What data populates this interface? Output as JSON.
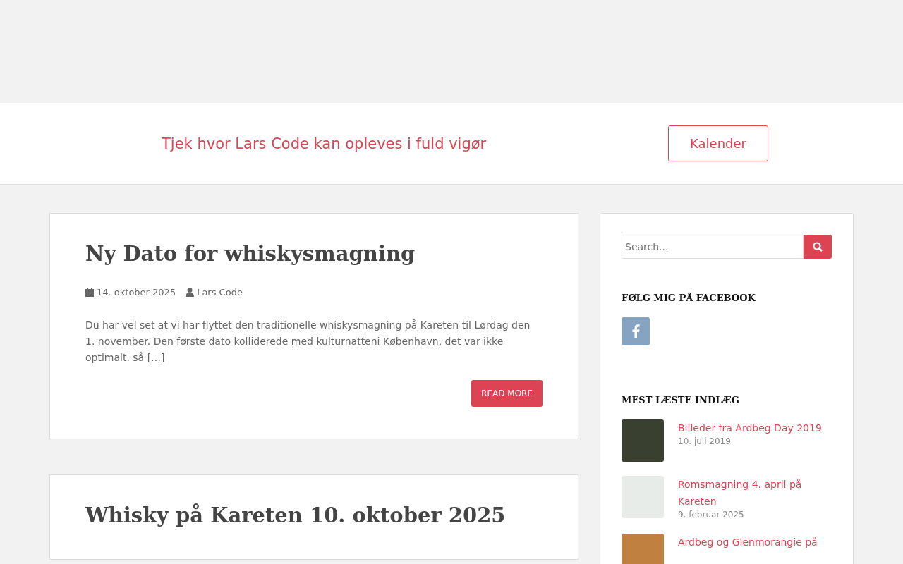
{
  "banner": {
    "text": "Tjek hvor Lars Code kan opleves i fuld vigør",
    "button": "Kalender"
  },
  "posts": [
    {
      "title": "Ny Dato for whiskysmagning",
      "date": "14. oktober 2025",
      "author": "Lars Code",
      "excerpt": "Du har vel set at vi har flyttet den traditionelle whiskysmagning på Kareten til Lørdag den 1. november. Den første dato kolliderede med kulturnatteni København, det var ikke optimalt. så […]",
      "button": "READ MORE"
    },
    {
      "title": "Whisky på Kareten 10. oktober 2025"
    }
  ],
  "sidebar": {
    "search": {
      "placeholder": "Search..."
    },
    "facebook_heading": "FØLG MIG PÅ FACEBOOK",
    "popular_heading": "MEST LÆSTE INDLÆG",
    "popular": [
      {
        "title": "Billeder fra Ardbeg Day 2019",
        "date": "10. juli 2019"
      },
      {
        "title": "Romsmagning 4. april på Kareten",
        "date": "9. februar 2025"
      },
      {
        "title": "Ardbeg og Glenmorangie på"
      }
    ]
  }
}
